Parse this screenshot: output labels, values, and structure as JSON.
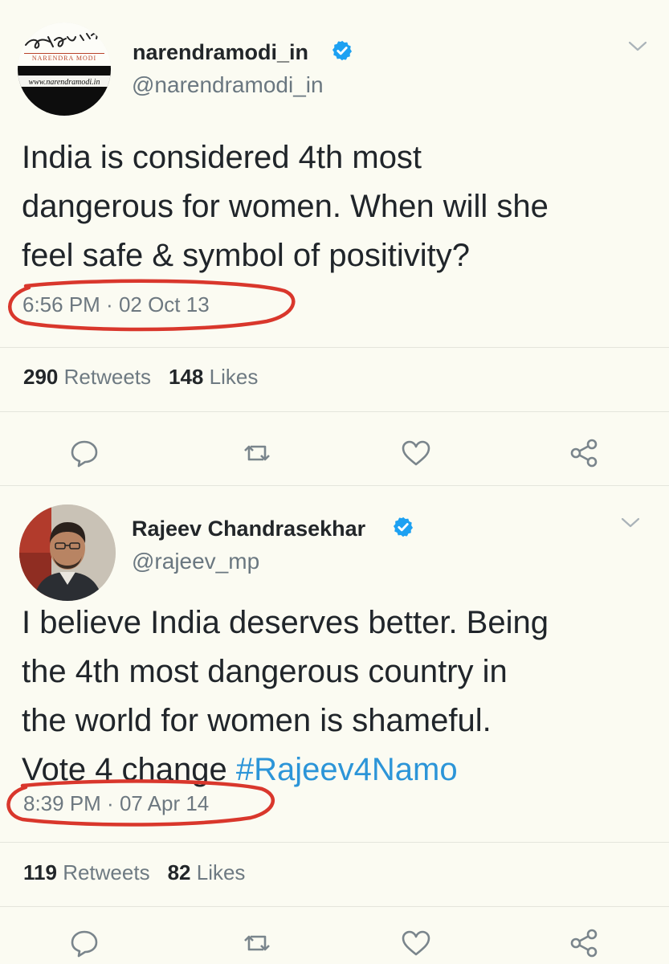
{
  "tweets": [
    {
      "author_name": "narendramodi_in",
      "handle": "@narendramodi_in",
      "avatar_caption": "NARENDRA MODI",
      "avatar_url_text": "www.narendramodi.in",
      "text_lines": [
        "India is considered 4th most",
        "dangerous for women. When will she",
        "feel safe & symbol of positivity?"
      ],
      "time": "6:56 PM",
      "date": "02 Oct 13",
      "retweets_count": "290",
      "retweets_label": "Retweets",
      "likes_count": "148",
      "likes_label": "Likes"
    },
    {
      "author_name": "Rajeev Chandrasekhar",
      "handle": "@rajeev_mp",
      "text_lines": [
        "I believe India deserves better. Being",
        "the 4th most dangerous country in",
        "the world for women is shameful."
      ],
      "text_last_prefix": "Vote 4 change ",
      "hashtag": "#Rajeev4Namo",
      "time": "8:39 PM",
      "date": "07 Apr 14",
      "retweets_count": "119",
      "retweets_label": "Retweets",
      "likes_count": "82",
      "likes_label": "Likes"
    }
  ],
  "separator": " · ",
  "colors": {
    "background": "#fbfbf2",
    "verified": "#1da1f2",
    "hashtag": "#2c95d8",
    "annotation_oval": "#d9372c",
    "icon_gray": "#7a858c"
  },
  "icons": [
    "verified-badge-icon",
    "chevron-down-icon",
    "reply-icon",
    "retweet-icon",
    "like-icon",
    "share-icon"
  ]
}
